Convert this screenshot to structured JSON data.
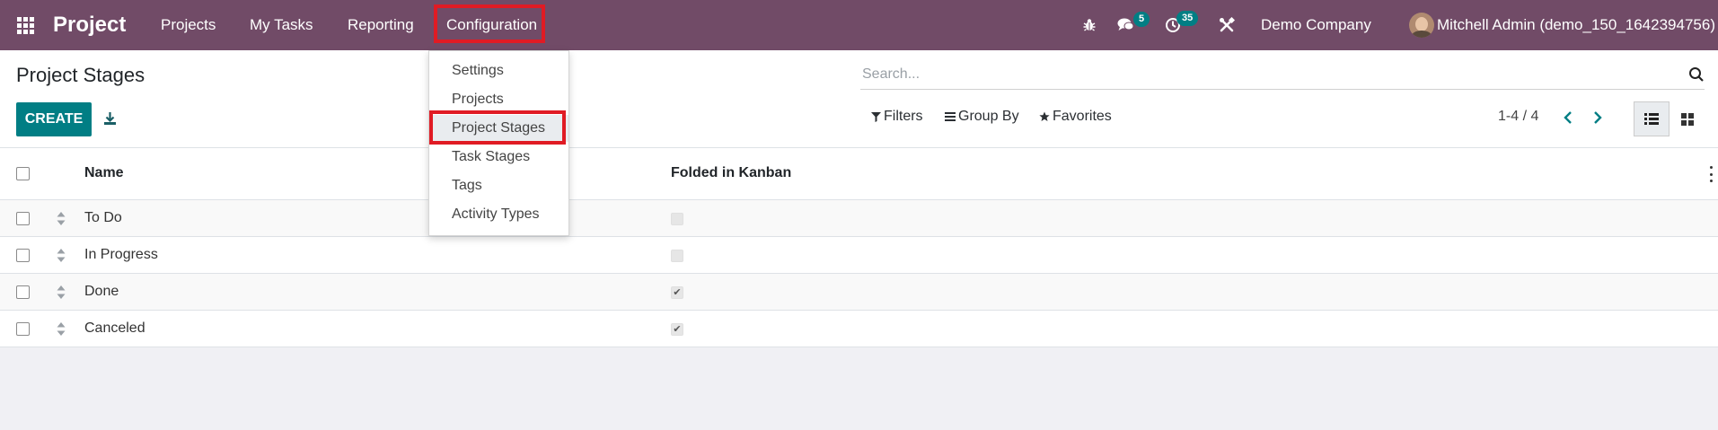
{
  "navbar": {
    "brand": "Project",
    "menus": [
      {
        "label": "Projects"
      },
      {
        "label": "My Tasks"
      },
      {
        "label": "Reporting"
      },
      {
        "label": "Configuration"
      }
    ],
    "message_count": "5",
    "activity_count": "35",
    "company": "Demo Company",
    "user": "Mitchell Admin (demo_150_1642394756)",
    "icons": [
      "apps-icon",
      "bug-icon",
      "chat-icon",
      "clock-icon",
      "tools-icon"
    ],
    "colors": {
      "bar": "#714b67",
      "badge": "#017e84",
      "highlight": "#e01b24"
    }
  },
  "control_panel": {
    "title": "Project Stages",
    "create_label": "CREATE",
    "search_placeholder": "Search...",
    "filters_label": "Filters",
    "groupby_label": "Group By",
    "favorites_label": "Favorites",
    "pager": "1-4 / 4"
  },
  "dropdown": {
    "items": [
      {
        "label": "Settings"
      },
      {
        "label": "Projects"
      },
      {
        "label": "Project Stages"
      },
      {
        "label": "Task Stages"
      },
      {
        "label": "Tags"
      },
      {
        "label": "Activity Types"
      }
    ],
    "selected": "Project Stages"
  },
  "table": {
    "columns": [
      "Name",
      "Folded in Kanban"
    ],
    "rows": [
      {
        "name": "To Do",
        "folded": false
      },
      {
        "name": "In Progress",
        "folded": false
      },
      {
        "name": "Done",
        "folded": true
      },
      {
        "name": "Canceled",
        "folded": true
      }
    ]
  }
}
